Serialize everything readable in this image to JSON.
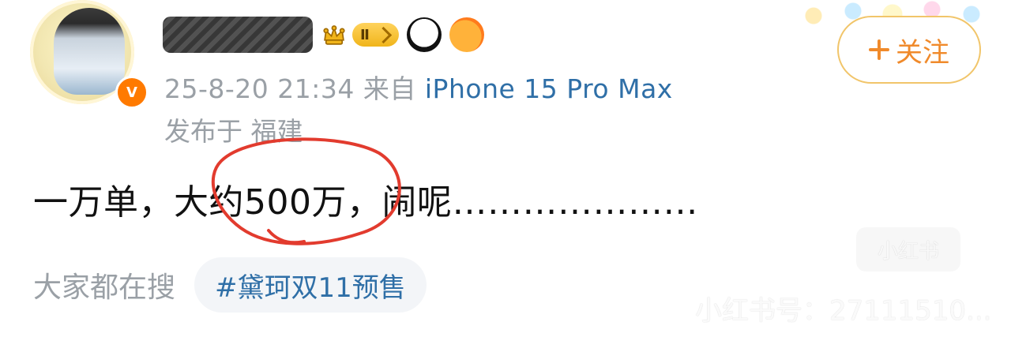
{
  "post": {
    "meta_time": "25-8-20 21:34",
    "meta_from": "来自",
    "meta_device": "iPhone 15 Pro Max",
    "location_prefix": "发布于",
    "location": "福建",
    "text": "一万单，大约500万，闹呢…………………",
    "follow_label": "关注"
  },
  "search": {
    "label": "大家都在搜",
    "trend": "#黛珂双11预售"
  },
  "watermark": {
    "text": "小红书号：27111510...",
    "logo": "小红书"
  },
  "icons": {
    "crown": "crown-icon",
    "panda": "panda-icon",
    "fish": "fish-icon",
    "plus": "plus-icon",
    "verified": "verified-badge"
  },
  "colors": {
    "meta_gray": "#9aa0a6",
    "link_blue": "#2f6fa7",
    "follow_orange": "#f08a2b",
    "pill_bg": "#f3f5f8",
    "annotation_red": "#e23b2e"
  }
}
